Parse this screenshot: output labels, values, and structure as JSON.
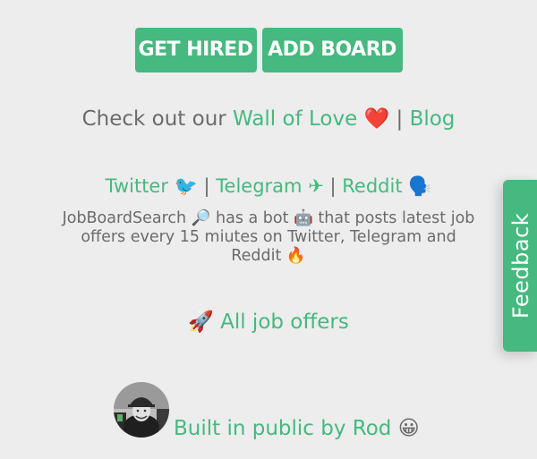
{
  "buttons": {
    "get_hired": "GET HIRED",
    "add_board": "ADD BOARD"
  },
  "wall_line": {
    "prefix": "Check out our",
    "wall_link": "Wall of Love",
    "heart": "❤️",
    "separator": "|",
    "blog_link": "Blog"
  },
  "social": {
    "twitter": "Twitter",
    "twitter_emoji": "🐦",
    "telegram": "Telegram",
    "telegram_emoji": "✈",
    "reddit": "Reddit",
    "reddit_emoji": "🗣️",
    "separator": "|"
  },
  "bot_text": {
    "line1": "JobBoardSearch 🔎 has a bot 🤖 that posts latest job",
    "line2": "offers every 15 miutes on Twitter, Telegram and",
    "line3": "Reddit 🔥"
  },
  "all_jobs": {
    "emoji": "🚀",
    "label": "All job offers"
  },
  "footer": {
    "built_text": "Built in public by Rod",
    "emoji": "😀"
  },
  "feedback": {
    "label": "Feedback"
  },
  "colors": {
    "accent": "#45b97f",
    "background": "#ededed",
    "text": "#6b6b6b"
  }
}
